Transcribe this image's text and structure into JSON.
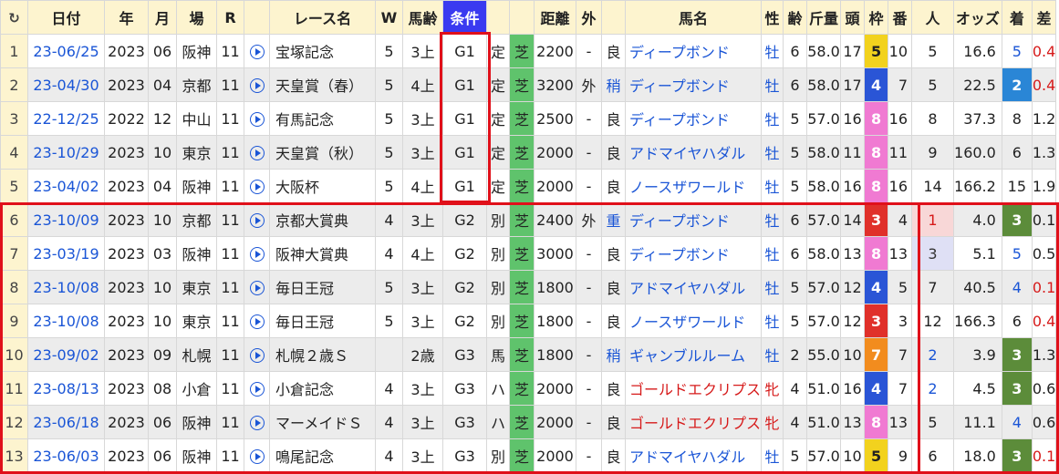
{
  "columns": [
    "日付",
    "年",
    "月",
    "場",
    "R",
    "レース名",
    "W",
    "馬齢",
    "条件",
    "",
    "距離",
    "外",
    "",
    "馬名",
    "性",
    "齢",
    "斤量",
    "頭",
    "枠",
    "番",
    "人",
    "オッズ",
    "着",
    "差"
  ],
  "reload_icon": "reload-icon",
  "rows": [
    {
      "idx": "1",
      "date": "23-06/25",
      "year": "2023",
      "month": "06",
      "place": "阪神",
      "r": "11",
      "race": "宝塚記念",
      "w": "5",
      "age": "3上",
      "cond": "G1",
      "kind": "定",
      "surface": "芝",
      "dist": "2200",
      "soto": "-",
      "baba": "良",
      "horse": "ディープボンド",
      "sex": "牡",
      "rei": "6",
      "kin": "58.0",
      "tou": "17",
      "waku": "5",
      "ban": "10",
      "nin": "5",
      "odds": "16.6",
      "chaku": "5",
      "sa": "0.4"
    },
    {
      "idx": "2",
      "date": "23-04/30",
      "year": "2023",
      "month": "04",
      "place": "京都",
      "r": "11",
      "race": "天皇賞（春）",
      "w": "5",
      "age": "4上",
      "cond": "G1",
      "kind": "定",
      "surface": "芝",
      "dist": "3200",
      "soto": "外",
      "baba": "稍",
      "horse": "ディープボンド",
      "sex": "牡",
      "rei": "6",
      "kin": "58.0",
      "tou": "17",
      "waku": "4",
      "ban": "7",
      "nin": "5",
      "odds": "22.5",
      "chaku": "2",
      "sa": "0.4"
    },
    {
      "idx": "3",
      "date": "22-12/25",
      "year": "2022",
      "month": "12",
      "place": "中山",
      "r": "11",
      "race": "有馬記念",
      "w": "5",
      "age": "3上",
      "cond": "G1",
      "kind": "定",
      "surface": "芝",
      "dist": "2500",
      "soto": "-",
      "baba": "良",
      "horse": "ディープボンド",
      "sex": "牡",
      "rei": "5",
      "kin": "57.0",
      "tou": "16",
      "waku": "8",
      "ban": "16",
      "nin": "8",
      "odds": "37.3",
      "chaku": "8",
      "sa": "1.2"
    },
    {
      "idx": "4",
      "date": "23-10/29",
      "year": "2023",
      "month": "10",
      "place": "東京",
      "r": "11",
      "race": "天皇賞（秋）",
      "w": "5",
      "age": "3上",
      "cond": "G1",
      "kind": "定",
      "surface": "芝",
      "dist": "2000",
      "soto": "-",
      "baba": "良",
      "horse": "アドマイヤハダル",
      "sex": "牡",
      "rei": "5",
      "kin": "58.0",
      "tou": "11",
      "waku": "8",
      "ban": "11",
      "nin": "9",
      "odds": "160.0",
      "chaku": "6",
      "sa": "1.3"
    },
    {
      "idx": "5",
      "date": "23-04/02",
      "year": "2023",
      "month": "04",
      "place": "阪神",
      "r": "11",
      "race": "大阪杯",
      "w": "5",
      "age": "4上",
      "cond": "G1",
      "kind": "定",
      "surface": "芝",
      "dist": "2000",
      "soto": "-",
      "baba": "良",
      "horse": "ノースザワールド",
      "sex": "牡",
      "rei": "5",
      "kin": "58.0",
      "tou": "16",
      "waku": "8",
      "ban": "16",
      "nin": "14",
      "odds": "166.2",
      "chaku": "15",
      "sa": "1.9"
    },
    {
      "idx": "6",
      "date": "23-10/09",
      "year": "2023",
      "month": "10",
      "place": "京都",
      "r": "11",
      "race": "京都大賞典",
      "w": "4",
      "age": "3上",
      "cond": "G2",
      "kind": "別",
      "surface": "芝",
      "dist": "2400",
      "soto": "外",
      "baba": "重",
      "horse": "ディープボンド",
      "sex": "牡",
      "rei": "6",
      "kin": "57.0",
      "tou": "14",
      "waku": "3",
      "ban": "4",
      "nin": "1",
      "odds": "4.0",
      "chaku": "3",
      "sa": "0.1"
    },
    {
      "idx": "7",
      "date": "23-03/19",
      "year": "2023",
      "month": "03",
      "place": "阪神",
      "r": "11",
      "race": "阪神大賞典",
      "w": "4",
      "age": "4上",
      "cond": "G2",
      "kind": "別",
      "surface": "芝",
      "dist": "3000",
      "soto": "-",
      "baba": "良",
      "horse": "ディープボンド",
      "sex": "牡",
      "rei": "6",
      "kin": "58.0",
      "tou": "13",
      "waku": "8",
      "ban": "13",
      "nin": "3",
      "odds": "5.1",
      "chaku": "5",
      "sa": "0.5"
    },
    {
      "idx": "8",
      "date": "23-10/08",
      "year": "2023",
      "month": "10",
      "place": "東京",
      "r": "11",
      "race": "毎日王冠",
      "w": "5",
      "age": "3上",
      "cond": "G2",
      "kind": "別",
      "surface": "芝",
      "dist": "1800",
      "soto": "-",
      "baba": "良",
      "horse": "アドマイヤハダル",
      "sex": "牡",
      "rei": "5",
      "kin": "57.0",
      "tou": "12",
      "waku": "4",
      "ban": "5",
      "nin": "7",
      "odds": "40.5",
      "chaku": "4",
      "sa": "0.1"
    },
    {
      "idx": "9",
      "date": "23-10/08",
      "year": "2023",
      "month": "10",
      "place": "東京",
      "r": "11",
      "race": "毎日王冠",
      "w": "5",
      "age": "3上",
      "cond": "G2",
      "kind": "別",
      "surface": "芝",
      "dist": "1800",
      "soto": "-",
      "baba": "良",
      "horse": "ノースザワールド",
      "sex": "牡",
      "rei": "5",
      "kin": "57.0",
      "tou": "12",
      "waku": "3",
      "ban": "3",
      "nin": "12",
      "odds": "166.3",
      "chaku": "6",
      "sa": "0.4"
    },
    {
      "idx": "10",
      "date": "23-09/02",
      "year": "2023",
      "month": "09",
      "place": "札幌",
      "r": "11",
      "race": "札幌２歳Ｓ",
      "w": "",
      "age": "2歳",
      "cond": "G3",
      "kind": "馬",
      "surface": "芝",
      "dist": "1800",
      "soto": "-",
      "baba": "稍",
      "horse": "ギャンブルルーム",
      "sex": "牡",
      "rei": "2",
      "kin": "55.0",
      "tou": "10",
      "waku": "7",
      "ban": "7",
      "nin": "2",
      "odds": "3.9",
      "chaku": "3",
      "sa": "1.3"
    },
    {
      "idx": "11",
      "date": "23-08/13",
      "year": "2023",
      "month": "08",
      "place": "小倉",
      "r": "11",
      "race": "小倉記念",
      "w": "4",
      "age": "3上",
      "cond": "G3",
      "kind": "ハ",
      "surface": "芝",
      "dist": "2000",
      "soto": "-",
      "baba": "良",
      "horse": "ゴールドエクリプス",
      "sex": "牝",
      "rei": "4",
      "kin": "51.0",
      "tou": "16",
      "waku": "4",
      "ban": "7",
      "nin": "2",
      "odds": "4.5",
      "chaku": "3",
      "sa": "0.6"
    },
    {
      "idx": "12",
      "date": "23-06/18",
      "year": "2023",
      "month": "06",
      "place": "阪神",
      "r": "11",
      "race": "マーメイドＳ",
      "w": "4",
      "age": "3上",
      "cond": "G3",
      "kind": "ハ",
      "surface": "芝",
      "dist": "2000",
      "soto": "-",
      "baba": "良",
      "horse": "ゴールドエクリプス",
      "sex": "牝",
      "rei": "4",
      "kin": "51.0",
      "tou": "13",
      "waku": "8",
      "ban": "13",
      "nin": "5",
      "odds": "11.1",
      "chaku": "4",
      "sa": "0.6"
    },
    {
      "idx": "13",
      "date": "23-06/03",
      "year": "2023",
      "month": "06",
      "place": "阪神",
      "r": "11",
      "race": "鳴尾記念",
      "w": "4",
      "age": "3上",
      "cond": "G3",
      "kind": "別",
      "surface": "芝",
      "dist": "2000",
      "soto": "-",
      "baba": "良",
      "horse": "アドマイヤハダル",
      "sex": "牡",
      "rei": "5",
      "kin": "57.0",
      "tou": "10",
      "waku": "5",
      "ban": "9",
      "nin": "6",
      "odds": "18.0",
      "chaku": "3",
      "sa": "0.1"
    }
  ],
  "waku_colors": {
    "1": "#ffffff",
    "2": "#222222",
    "3": "#e0302a",
    "4": "#2a55d6",
    "5": "#f2d21e",
    "6": "#3aa84a",
    "7": "#f28c1e",
    "8": "#f07ad2"
  },
  "accent": "#e0101a"
}
